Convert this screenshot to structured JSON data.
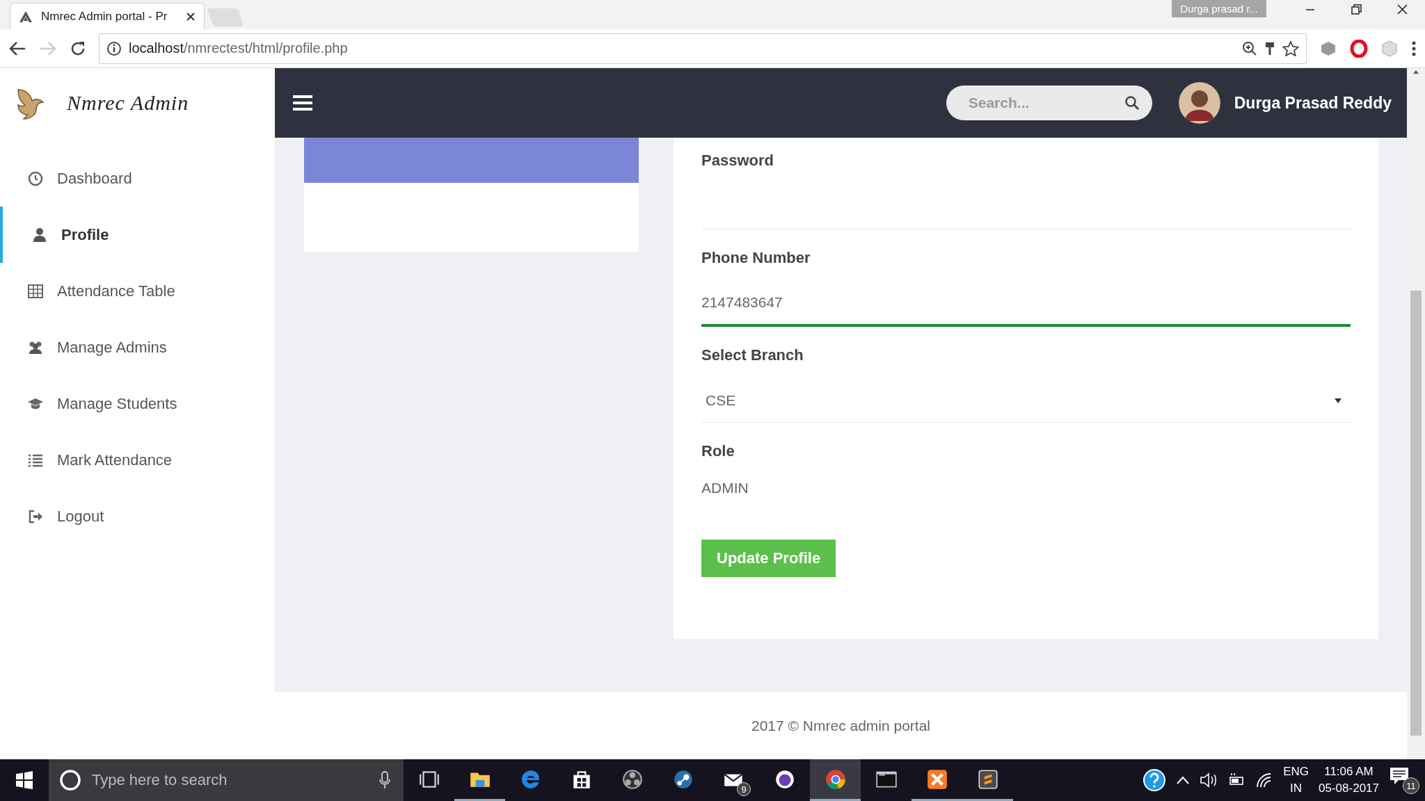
{
  "browser": {
    "tab_title": "Nmrec Admin portal - Pr",
    "url_host": "localhost",
    "url_path": "/nmrectest/html/profile.php",
    "profile_badge": "Durga prasad r..."
  },
  "sidebar": {
    "brand": "Nmrec Admin",
    "items": [
      {
        "label": "Dashboard",
        "kind": "clock",
        "selected": false
      },
      {
        "label": "Profile",
        "kind": "user",
        "selected": true
      },
      {
        "label": "Attendance Table",
        "kind": "table",
        "selected": false
      },
      {
        "label": "Manage Admins",
        "kind": "users",
        "selected": false
      },
      {
        "label": "Manage Students",
        "kind": "cap",
        "selected": false
      },
      {
        "label": "Mark Attendance",
        "kind": "list",
        "selected": false
      },
      {
        "label": "Logout",
        "kind": "logout",
        "selected": false
      }
    ]
  },
  "header": {
    "search": {
      "placeholder": "Search..."
    },
    "user_name": "Durga Prasad Reddy"
  },
  "form": {
    "fields": [
      {
        "label": "Password",
        "kind": "input",
        "focused": false
      },
      {
        "label": "Phone Number",
        "kind": "input",
        "value": "2147483647",
        "focused": true
      },
      {
        "label": "Select Branch",
        "kind": "select",
        "value": "CSE"
      },
      {
        "label": "Role",
        "kind": "static",
        "value": "ADMIN"
      }
    ],
    "submit": "Update Profile"
  },
  "footer": "2017 © Nmrec admin portal",
  "taskbar": {
    "search": {
      "placeholder": "Type here to search"
    },
    "apps": [
      {
        "kind": "taskview",
        "open": false,
        "selected": false
      },
      {
        "kind": "folder",
        "open": true,
        "selected": false
      },
      {
        "kind": "edge",
        "open": false,
        "selected": false
      },
      {
        "kind": "store",
        "open": false,
        "selected": false
      },
      {
        "kind": "obs",
        "open": false,
        "selected": false
      },
      {
        "kind": "steam",
        "open": false,
        "selected": false
      },
      {
        "kind": "mail",
        "open": false,
        "selected": false,
        "badge": "9"
      },
      {
        "kind": "purple",
        "open": false,
        "selected": false
      },
      {
        "kind": "chrome",
        "open": true,
        "selected": true
      },
      {
        "kind": "terminal",
        "open": false,
        "selected": false
      },
      {
        "kind": "xampp",
        "open": true,
        "selected": false
      },
      {
        "kind": "sublime",
        "open": true,
        "selected": false
      }
    ],
    "language": "ENG",
    "region": "IN",
    "time": "11:06 AM",
    "date": "05-08-2017",
    "notifications": "11"
  }
}
